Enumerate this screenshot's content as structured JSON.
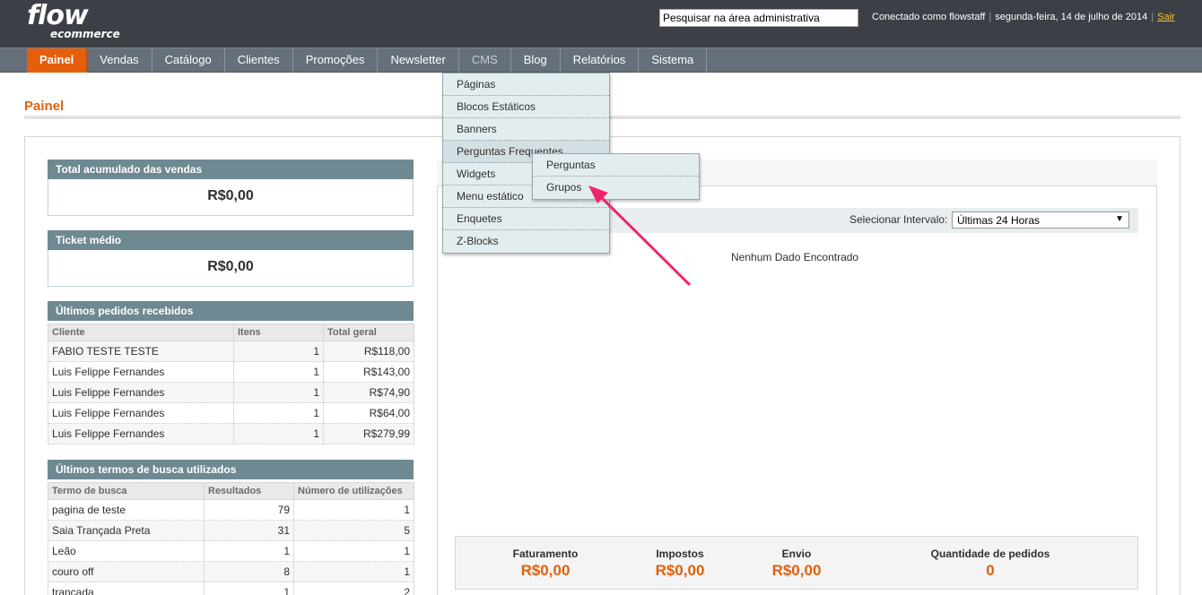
{
  "header": {
    "logo_main": "flow",
    "logo_sub": "ecommerce",
    "search_placeholder": "Pesquisar na área administrativa",
    "logged_in": "Conectado como flowstaff",
    "date": "segunda-feira, 14 de julho de 2014",
    "logout": "Sair"
  },
  "nav": {
    "items": [
      "Painel",
      "Vendas",
      "Catálogo",
      "Clientes",
      "Promoções",
      "Newsletter",
      "CMS",
      "Blog",
      "Relatórios",
      "Sistema"
    ]
  },
  "cms_menu": {
    "items": [
      "Páginas",
      "Blocos Estáticos",
      "Banners",
      "Perguntas Frequentes",
      "Widgets",
      "Menu estático",
      "Enquetes",
      "Z-Blocks"
    ],
    "submenu": [
      "Perguntas",
      "Grupos"
    ]
  },
  "page": {
    "title": "Painel"
  },
  "lifetime_sales": {
    "title": "Total acumulado das vendas",
    "value": "R$0,00"
  },
  "average_order": {
    "title": "Ticket médio",
    "value": "R$0,00"
  },
  "last_orders": {
    "title": "Últimos pedidos recebidos",
    "columns": [
      "Cliente",
      "Itens",
      "Total geral"
    ],
    "rows": [
      [
        "FABIO TESTE TESTE",
        "1",
        "R$118,00"
      ],
      [
        "Luis Felippe Fernandes",
        "1",
        "R$143,00"
      ],
      [
        "Luis Felippe Fernandes",
        "1",
        "R$74,90"
      ],
      [
        "Luis Felippe Fernandes",
        "1",
        "R$64,00"
      ],
      [
        "Luis Felippe Fernandes",
        "1",
        "R$279,99"
      ]
    ]
  },
  "last_search": {
    "title": "Últimos termos de busca utilizados",
    "columns": [
      "Termo de busca",
      "Resultados",
      "Número de utilizações"
    ],
    "rows": [
      [
        "pagina de teste",
        "79",
        "1"
      ],
      [
        "Saia Trançada Preta",
        "31",
        "5"
      ],
      [
        "Leão",
        "1",
        "1"
      ],
      [
        "couro off",
        "8",
        "1"
      ],
      [
        "trançada",
        "1",
        "2"
      ]
    ]
  },
  "chart": {
    "range_label": "Selecionar Intervalo:",
    "range_value": "Últimas 24 Horas",
    "no_data": "Nenhum Dado Encontrado"
  },
  "totals": {
    "revenue_label": "Faturamento",
    "revenue_value": "R$0,00",
    "tax_label": "Impostos",
    "tax_value": "R$0,00",
    "shipping_label": "Envio",
    "shipping_value": "R$0,00",
    "qty_label": "Quantidade de pedidos",
    "qty_value": "0"
  },
  "colors": {
    "accent": "#e55e0c",
    "header_bg": "#3c3f45",
    "nav_bg": "#65707b",
    "panel_head": "#6f8992",
    "annotation_arrow": "#f0246e"
  }
}
